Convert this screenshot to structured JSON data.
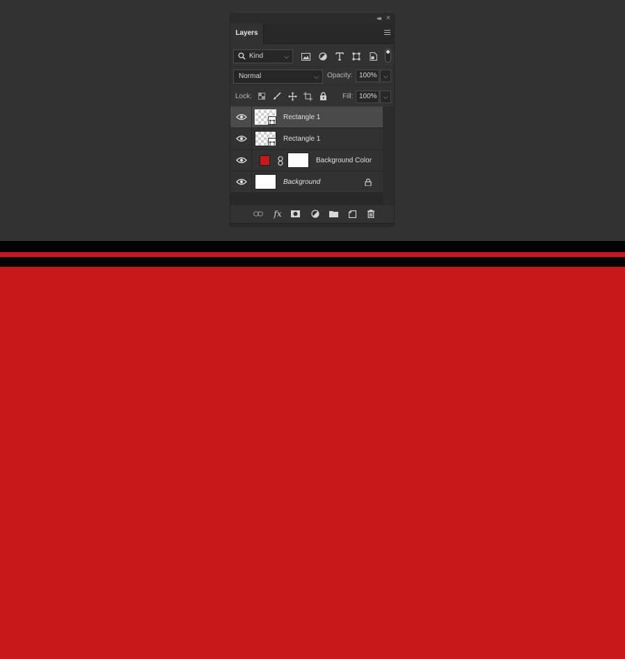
{
  "panel": {
    "tab_label": "Layers",
    "filter": {
      "kind_label": "Kind"
    },
    "blend_mode": "Normal",
    "opacity_label": "Opacity:",
    "opacity_value": "100%",
    "lock_label": "Lock:",
    "fill_label": "Fill:",
    "fill_value": "100%"
  },
  "layers": [
    {
      "name": "Rectangle 1",
      "visible": true,
      "selected": true
    },
    {
      "name": "Rectangle 1",
      "visible": true,
      "selected": false
    },
    {
      "name": "Background Color",
      "visible": true,
      "selected": false,
      "fill_color": "#c8191a"
    },
    {
      "name": "Background",
      "visible": true,
      "selected": false,
      "locked": true
    }
  ],
  "colors": {
    "canvas_red": "#c8191a",
    "band_black": "#020202",
    "panel_bg": "#323232",
    "selected_row": "#4a4a4a"
  },
  "icons": {
    "filter": [
      "image-filter-icon",
      "adjustment-filter-icon",
      "type-filter-icon",
      "shape-filter-icon",
      "smart-object-filter-icon"
    ],
    "lock": [
      "lock-transparent-pixels-icon",
      "lock-image-pixels-icon",
      "lock-position-icon",
      "lock-artboard-icon",
      "lock-all-icon"
    ],
    "footer": [
      "link-layers-icon",
      "fx-icon",
      "add-mask-icon",
      "adjustment-layer-icon",
      "new-group-icon",
      "new-layer-icon",
      "trash-icon"
    ]
  }
}
